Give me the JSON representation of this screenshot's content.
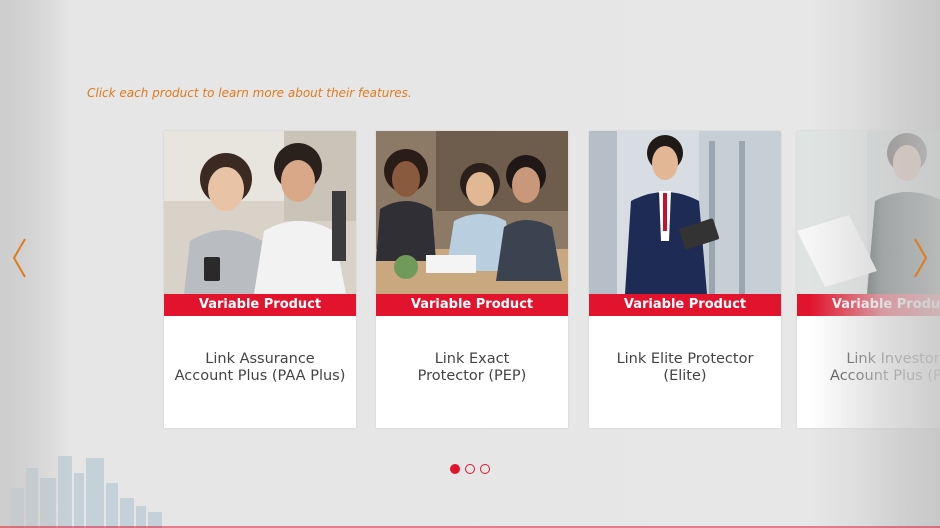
{
  "instruction": "Click each product to learn more about their features.",
  "colors": {
    "accent": "#e2142d",
    "instruction": "#e07b1d",
    "arrow": "#e07b1d"
  },
  "products": [
    {
      "badge": "Variable Product",
      "title_lines": [
        "Link Assurance",
        "Account Plus (PAA Plus)"
      ]
    },
    {
      "badge": "Variable Product",
      "title_lines": [
        "Link Exact",
        "Protector (PEP)"
      ]
    },
    {
      "badge": "Variable Product",
      "title_lines": [
        "Link Elite Protector (Elite)"
      ]
    },
    {
      "badge": "Variable Product",
      "title_lines": [
        "Link Investor",
        "Account Plus (PIA"
      ]
    }
  ],
  "pagination": {
    "count": 3,
    "active": 1
  },
  "icons": {
    "prev": "chevron-left-icon",
    "next": "chevron-right-icon"
  }
}
